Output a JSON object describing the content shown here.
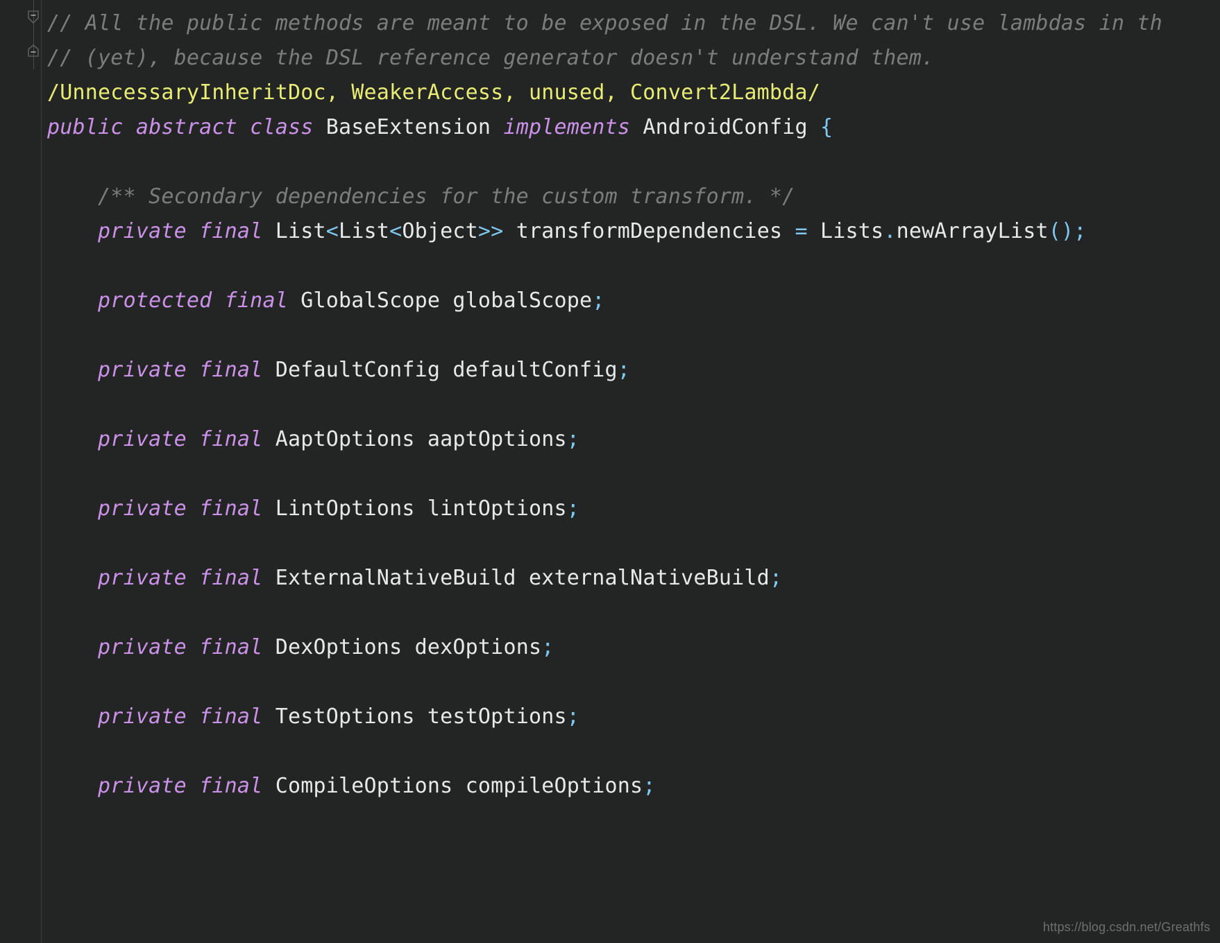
{
  "editor": {
    "theme": "darcula",
    "background_color": "#232525",
    "gutter_background_color": "#232525",
    "gutter_border_color": "#3a3c3c",
    "language": "Java"
  },
  "colors": {
    "comment": "#7c7c7c",
    "annotation": "#e8ec73",
    "keyword": "#cb91e8",
    "identifier": "#e8e8e8",
    "punctuation": "#7fc8f0",
    "watermark": "#6e7070"
  },
  "gutter": {
    "fold_markers": [
      {
        "name": "fold-marker-collapse-comment-block",
        "state": "expanded",
        "glyph": "minus"
      },
      {
        "name": "fold-marker-collapse-comment-end",
        "state": "expanded",
        "glyph": "minus"
      }
    ]
  },
  "watermark": {
    "text": "https://blog.csdn.net/Greathfs"
  },
  "code": {
    "lines": [
      {
        "id": "line-comment-1",
        "kind": "comment",
        "tokens": [
          {
            "t": "// All the public methods are meant to be exposed in the DSL. We can't use lambdas in th",
            "c": "comment"
          }
        ]
      },
      {
        "id": "line-comment-2",
        "kind": "comment",
        "tokens": [
          {
            "t": "// (yet), because the DSL reference generator doesn't understand them.",
            "c": "comment"
          }
        ]
      },
      {
        "id": "line-annotation",
        "kind": "annotation",
        "tokens": [
          {
            "t": "/UnnecessaryInheritDoc, WeakerAccess, unused, Convert2Lambda/",
            "c": "annot"
          }
        ]
      },
      {
        "id": "line-class-declaration",
        "kind": "declaration",
        "tokens": [
          {
            "t": "public abstract class",
            "c": "keyword"
          },
          {
            "t": " ",
            "c": "plain"
          },
          {
            "t": "BaseExtension",
            "c": "type"
          },
          {
            "t": " ",
            "c": "plain"
          },
          {
            "t": "implements",
            "c": "keyword"
          },
          {
            "t": " ",
            "c": "plain"
          },
          {
            "t": "AndroidConfig",
            "c": "type"
          },
          {
            "t": " ",
            "c": "plain"
          },
          {
            "t": "{",
            "c": "punct"
          }
        ]
      },
      {
        "id": "line-blank-1",
        "kind": "blank",
        "tokens": []
      },
      {
        "id": "line-javadoc",
        "kind": "comment",
        "indent": 4,
        "tokens": [
          {
            "t": "/** Secondary dependencies for the custom transform. */",
            "c": "comment"
          }
        ]
      },
      {
        "id": "line-field-transformDependencies",
        "kind": "field",
        "indent": 4,
        "tokens": [
          {
            "t": "private final",
            "c": "keyword"
          },
          {
            "t": " ",
            "c": "plain"
          },
          {
            "t": "List",
            "c": "type"
          },
          {
            "t": "<",
            "c": "punct"
          },
          {
            "t": "List",
            "c": "type"
          },
          {
            "t": "<",
            "c": "punct"
          },
          {
            "t": "Object",
            "c": "type"
          },
          {
            "t": ">>",
            "c": "punct"
          },
          {
            "t": " ",
            "c": "plain"
          },
          {
            "t": "transformDependencies",
            "c": "ident"
          },
          {
            "t": " ",
            "c": "plain"
          },
          {
            "t": "=",
            "c": "punct"
          },
          {
            "t": " ",
            "c": "plain"
          },
          {
            "t": "Lists",
            "c": "type"
          },
          {
            "t": ".",
            "c": "punct"
          },
          {
            "t": "newArrayList",
            "c": "ident"
          },
          {
            "t": "();",
            "c": "punct"
          }
        ]
      },
      {
        "id": "line-blank-2",
        "kind": "blank",
        "tokens": []
      },
      {
        "id": "line-field-globalScope",
        "kind": "field",
        "indent": 4,
        "tokens": [
          {
            "t": "protected final",
            "c": "keyword"
          },
          {
            "t": " ",
            "c": "plain"
          },
          {
            "t": "GlobalScope",
            "c": "type"
          },
          {
            "t": " ",
            "c": "plain"
          },
          {
            "t": "globalScope",
            "c": "ident"
          },
          {
            "t": ";",
            "c": "punct"
          }
        ]
      },
      {
        "id": "line-blank-3",
        "kind": "blank",
        "tokens": []
      },
      {
        "id": "line-field-defaultConfig",
        "kind": "field",
        "indent": 4,
        "tokens": [
          {
            "t": "private final",
            "c": "keyword"
          },
          {
            "t": " ",
            "c": "plain"
          },
          {
            "t": "DefaultConfig",
            "c": "type"
          },
          {
            "t": " ",
            "c": "plain"
          },
          {
            "t": "defaultConfig",
            "c": "ident"
          },
          {
            "t": ";",
            "c": "punct"
          }
        ]
      },
      {
        "id": "line-blank-4",
        "kind": "blank",
        "tokens": []
      },
      {
        "id": "line-field-aaptOptions",
        "kind": "field",
        "indent": 4,
        "tokens": [
          {
            "t": "private final",
            "c": "keyword"
          },
          {
            "t": " ",
            "c": "plain"
          },
          {
            "t": "AaptOptions",
            "c": "type"
          },
          {
            "t": " ",
            "c": "plain"
          },
          {
            "t": "aaptOptions",
            "c": "ident"
          },
          {
            "t": ";",
            "c": "punct"
          }
        ]
      },
      {
        "id": "line-blank-5",
        "kind": "blank",
        "tokens": []
      },
      {
        "id": "line-field-lintOptions",
        "kind": "field",
        "indent": 4,
        "tokens": [
          {
            "t": "private final",
            "c": "keyword"
          },
          {
            "t": " ",
            "c": "plain"
          },
          {
            "t": "LintOptions",
            "c": "type"
          },
          {
            "t": " ",
            "c": "plain"
          },
          {
            "t": "lintOptions",
            "c": "ident"
          },
          {
            "t": ";",
            "c": "punct"
          }
        ]
      },
      {
        "id": "line-blank-6",
        "kind": "blank",
        "tokens": []
      },
      {
        "id": "line-field-externalNativeBuild",
        "kind": "field",
        "indent": 4,
        "tokens": [
          {
            "t": "private final",
            "c": "keyword"
          },
          {
            "t": " ",
            "c": "plain"
          },
          {
            "t": "ExternalNativeBuild",
            "c": "type"
          },
          {
            "t": " ",
            "c": "plain"
          },
          {
            "t": "externalNativeBuild",
            "c": "ident"
          },
          {
            "t": ";",
            "c": "punct"
          }
        ]
      },
      {
        "id": "line-blank-7",
        "kind": "blank",
        "tokens": []
      },
      {
        "id": "line-field-dexOptions",
        "kind": "field",
        "indent": 4,
        "tokens": [
          {
            "t": "private final",
            "c": "keyword"
          },
          {
            "t": " ",
            "c": "plain"
          },
          {
            "t": "DexOptions",
            "c": "type"
          },
          {
            "t": " ",
            "c": "plain"
          },
          {
            "t": "dexOptions",
            "c": "ident"
          },
          {
            "t": ";",
            "c": "punct"
          }
        ]
      },
      {
        "id": "line-blank-8",
        "kind": "blank",
        "tokens": []
      },
      {
        "id": "line-field-testOptions",
        "kind": "field",
        "indent": 4,
        "tokens": [
          {
            "t": "private final",
            "c": "keyword"
          },
          {
            "t": " ",
            "c": "plain"
          },
          {
            "t": "TestOptions",
            "c": "type"
          },
          {
            "t": " ",
            "c": "plain"
          },
          {
            "t": "testOptions",
            "c": "ident"
          },
          {
            "t": ";",
            "c": "punct"
          }
        ]
      },
      {
        "id": "line-blank-9",
        "kind": "blank",
        "tokens": []
      },
      {
        "id": "line-field-compileOptions",
        "kind": "field",
        "indent": 4,
        "tokens": [
          {
            "t": "private final",
            "c": "keyword"
          },
          {
            "t": " ",
            "c": "plain"
          },
          {
            "t": "CompileOptions",
            "c": "type"
          },
          {
            "t": " ",
            "c": "plain"
          },
          {
            "t": "compileOptions",
            "c": "ident"
          },
          {
            "t": ";",
            "c": "punct"
          }
        ]
      },
      {
        "id": "line-blank-10",
        "kind": "blank",
        "tokens": []
      }
    ]
  }
}
